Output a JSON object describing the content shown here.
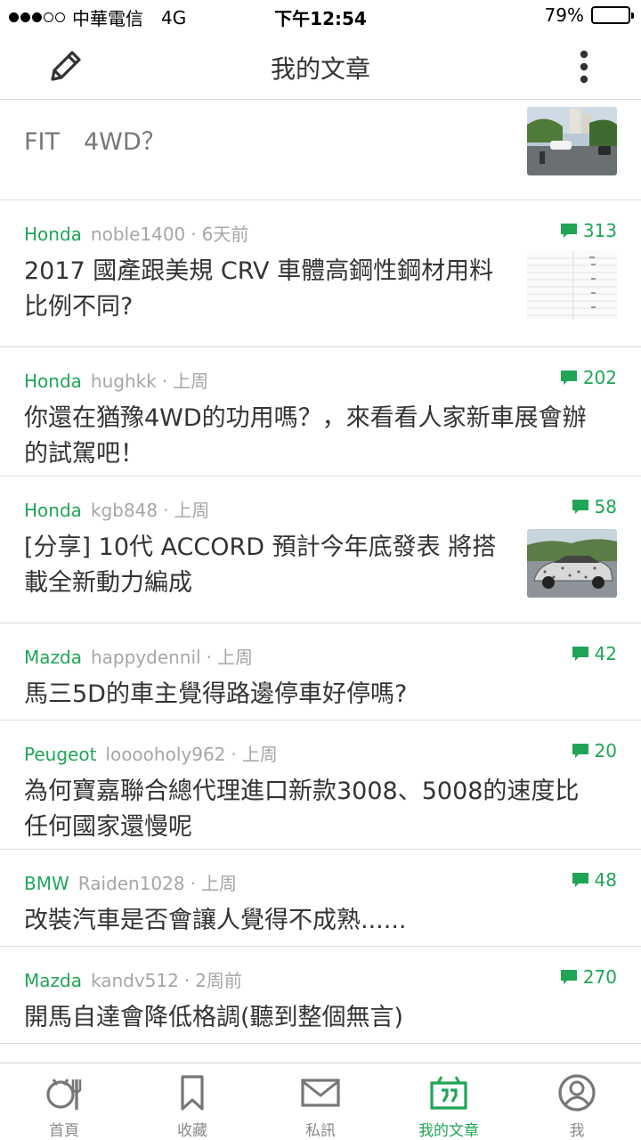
{
  "status_bar": {
    "carrier": "中華電信",
    "network": "4G",
    "time": "下午12:54",
    "battery": "79%",
    "battery_level": 0.79,
    "signal_bars": 3
  },
  "nav": {
    "title": "我的文章",
    "left_icon": "pencil-icon",
    "right_icon": "more-vertical-icon"
  },
  "colors": {
    "accent": "#20a557",
    "meta_gray": "#a6a6a6",
    "title_text": "#333333",
    "divider": "#dcdcdc"
  },
  "partial_article": {
    "title": "FIT　4WD？"
  },
  "articles": [
    {
      "brand": "Honda",
      "author": "noble1400",
      "time": "6天前",
      "comments": "313",
      "title": "2017 國產跟美規 CRV 車體高鋼性鋼材用料比例不同?"
    },
    {
      "brand": "Honda",
      "author": "hughkk",
      "time": "上周",
      "comments": "202",
      "title": "你還在猶豫4WD的功用嗎？，來看看人家新車展會辦的試駕吧！"
    },
    {
      "brand": "Honda",
      "author": "kgb848",
      "time": "上周",
      "comments": "58",
      "title": "[分享] 10代 ACCORD 預計今年底發表  將搭載全新動力編成"
    },
    {
      "brand": "Mazda",
      "author": "happydennil",
      "time": "上周",
      "comments": "42",
      "title": "馬三5D的車主覺得路邊停車好停嗎?"
    },
    {
      "brand": "Peugeot",
      "author": "looooholy962",
      "time": "上周",
      "comments": "20",
      "title": "為何寶嘉聯合總代理進口新款3008、5008的速度比任何國家還慢呢"
    },
    {
      "brand": "BMW",
      "author": "Raiden1028",
      "time": "上周",
      "comments": "48",
      "title": "改裝汽車是否會讓人覺得不成熟......"
    },
    {
      "brand": "Mazda",
      "author": "kandv512",
      "time": "2周前",
      "comments": "270",
      "title": "開馬自達會降低格調(聽到整個無言)"
    }
  ],
  "meta_separator": "·",
  "tabs": [
    {
      "label": "首頁",
      "icon": "home-dining-icon",
      "active": false
    },
    {
      "label": "收藏",
      "icon": "bookmark-icon",
      "active": false
    },
    {
      "label": "私訊",
      "icon": "mail-icon",
      "active": false
    },
    {
      "label": "我的文章",
      "icon": "my-articles-icon",
      "active": true
    },
    {
      "label": "我",
      "icon": "user-icon",
      "active": false
    }
  ]
}
